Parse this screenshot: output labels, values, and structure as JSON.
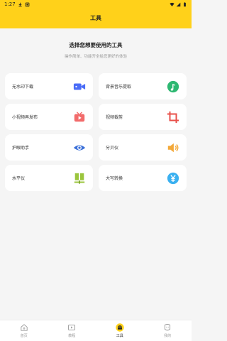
{
  "status": {
    "time": "1:27"
  },
  "header": {
    "title": "工具"
  },
  "intro": {
    "headline": "选择您想要使用的工具",
    "subline": "操作简单、功能齐全给您更好的体验"
  },
  "tools": [
    {
      "label": "无水印下载",
      "icon": "video-camera-icon",
      "color": "#4a6cf7"
    },
    {
      "label": "背景音乐提取",
      "icon": "music-note-icon",
      "color": "#2eb872"
    },
    {
      "label": "小视频再发布",
      "icon": "tv-play-icon",
      "color": "#f26b6b"
    },
    {
      "label": "视频裁剪",
      "icon": "crop-icon",
      "color": "#e8504a"
    },
    {
      "label": "护眼助手",
      "icon": "eye-icon",
      "color": "#3a6fd8"
    },
    {
      "label": "分贝仪",
      "icon": "speaker-icon",
      "color": "#f3a93a"
    },
    {
      "label": "水平仪",
      "icon": "level-icon",
      "color": "#9bc53d"
    },
    {
      "label": "大写转换",
      "icon": "yen-icon",
      "color": "#3ab0f0"
    }
  ],
  "bottom_nav": [
    {
      "label": "首页",
      "icon": "home-icon",
      "active": false
    },
    {
      "label": "教程",
      "icon": "tutorial-play-icon",
      "active": false
    },
    {
      "label": "工具",
      "icon": "toolbox-icon",
      "active": true
    },
    {
      "label": "我的",
      "icon": "profile-icon",
      "active": false
    }
  ],
  "colors": {
    "brand": "#ffd11a"
  }
}
